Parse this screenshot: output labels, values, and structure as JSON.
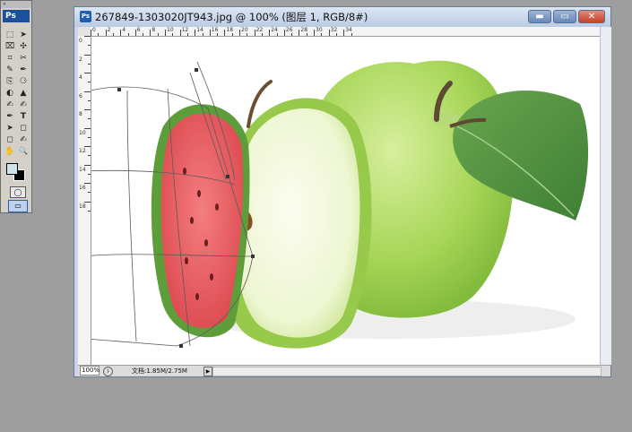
{
  "toolbox": {
    "grip_label": "«",
    "app_badge": "Ps",
    "tools": [
      "⬚",
      "➤",
      "⌧",
      "✣",
      "⌗",
      "✂",
      "✎",
      "✒",
      "⎘",
      "⚆",
      "◐",
      "▲",
      "✍",
      "T",
      "➤",
      "◻",
      "◻",
      "✍",
      "✋",
      "🔍"
    ]
  },
  "document": {
    "app_badge": "Ps",
    "title": "267849-1303020JT943.jpg @ 100% (图层 1, RGB/8#)",
    "minimize_symbol": "▬",
    "maximize_symbol": "▭",
    "close_symbol": "✕",
    "ruler_top_numbers": [
      "0",
      "2",
      "4",
      "6",
      "8",
      "10",
      "12",
      "14",
      "16",
      "18",
      "20",
      "22",
      "24",
      "26",
      "28",
      "30",
      "32",
      "34"
    ],
    "ruler_left_numbers": [
      "0",
      "2",
      "4",
      "6",
      "8",
      "10",
      "12",
      "14",
      "16",
      "18"
    ],
    "status": {
      "zoom": "100%",
      "info_icon": "i",
      "doc_size": "文档:1.85M/2.75M",
      "menu_arrow": "▶"
    }
  },
  "colors": {
    "foreground": "#cfe3ea",
    "background": "#000000",
    "workspace": "#9e9e9e",
    "apple_green": "#9bcf4f",
    "watermelon_red": "#e8555a"
  }
}
